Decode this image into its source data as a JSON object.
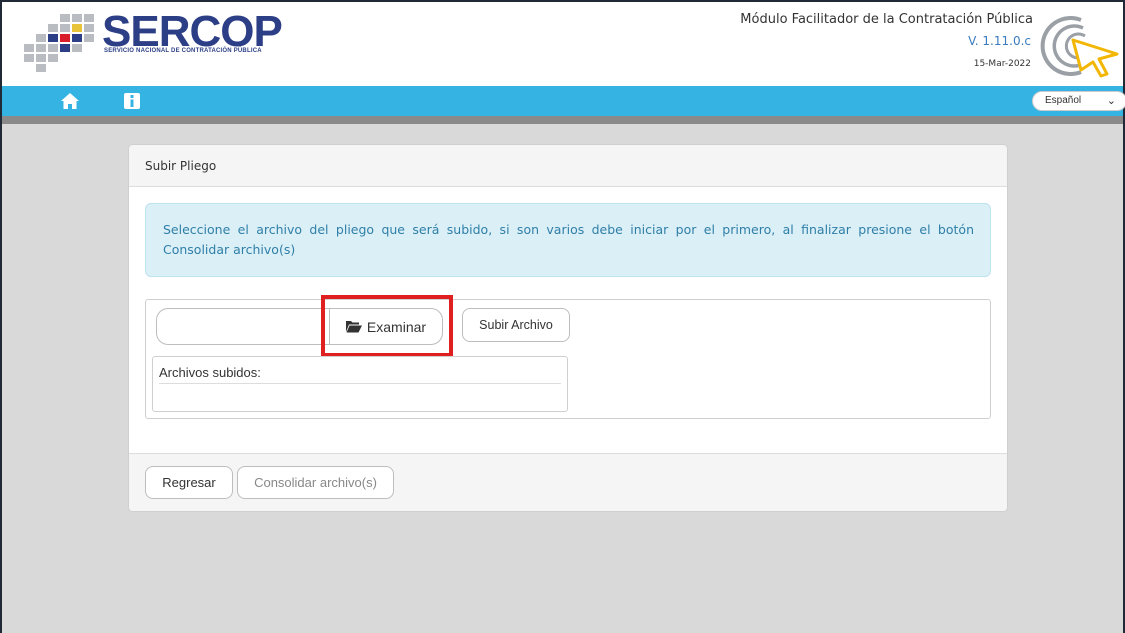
{
  "header": {
    "logo_text": "SERCOP",
    "logo_subtext": "SERVICIO NACIONAL DE CONTRATACIÓN PÚBLICA",
    "app_title": "Módulo Facilitador de la Contratación Pública",
    "version": "V. 1.11.0.c",
    "date": "15-Mar-2022"
  },
  "navbar": {
    "home_icon": "home-icon",
    "info_icon": "info-icon",
    "language": "Español"
  },
  "panel": {
    "title": "Subir Pliego",
    "alert_text": "Seleccione el archivo del pliego que será subido, si son varios debe iniciar por el primero, al finalizar presione el botón Consolidar archivo(s)",
    "browse_label": "Examinar",
    "upload_label": "Subir Archivo",
    "uploaded_files_label": "Archivos subidos:",
    "back_label": "Regresar",
    "consolidate_label": "Consolidar archivo(s)"
  },
  "colors": {
    "navbar": "#35b4e4",
    "brand": "#2c3f86",
    "highlight": "#e02020",
    "alert_text": "#2f7fa8"
  }
}
